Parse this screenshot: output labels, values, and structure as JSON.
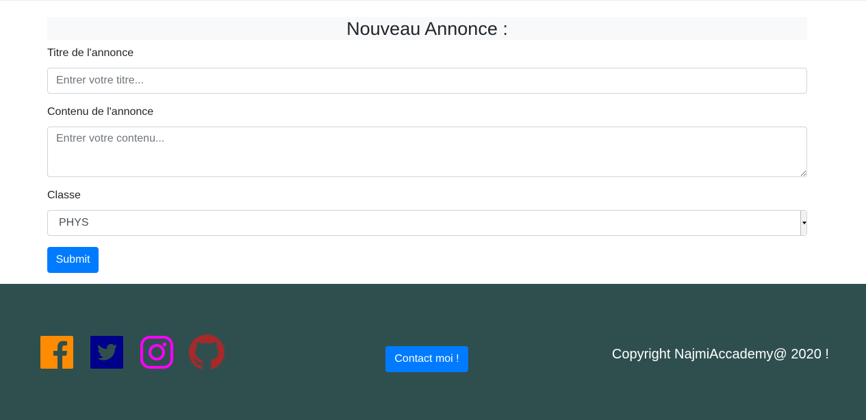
{
  "form": {
    "title": "Nouveau Annonce :",
    "titre_label": "Titre de l'annonce",
    "titre_placeholder": "Entrer votre titre...",
    "contenu_label": "Contenu de l'annonce",
    "contenu_placeholder": "Entrer votre contenu...",
    "classe_label": "Classe",
    "classe_selected": "PHYS",
    "submit_label": "Submit"
  },
  "footer": {
    "social_icons": [
      {
        "name": "facebook-icon",
        "color": "#ff8c00"
      },
      {
        "name": "twitter-icon",
        "color": "#00008b"
      },
      {
        "name": "instagram-icon",
        "color": "#ff00ff"
      },
      {
        "name": "github-icon",
        "color": "#a52a2a"
      }
    ],
    "contact_label": "Contact moi !",
    "copyright": "Copyright NajmiAccademy@ 2020 !",
    "background": "#2f4f4f"
  },
  "colors": {
    "primary": "#007bff"
  }
}
